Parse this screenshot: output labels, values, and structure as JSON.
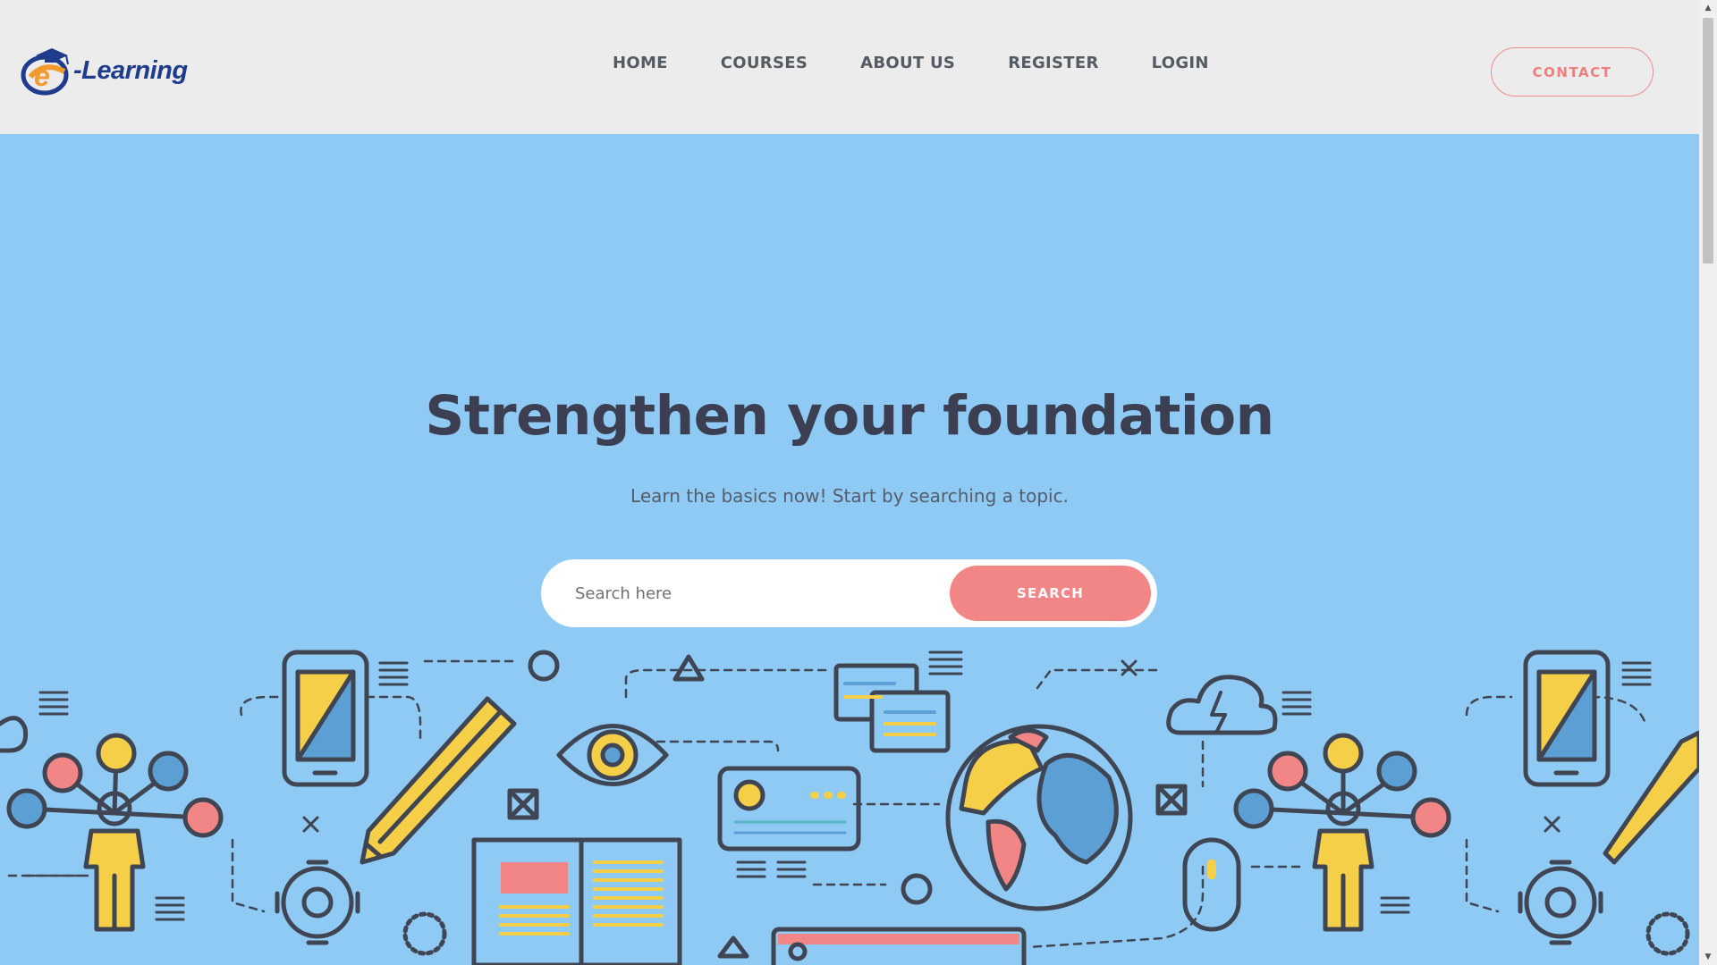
{
  "brand": {
    "logo_text": "-Learning"
  },
  "nav": {
    "items": [
      {
        "label": "HOME"
      },
      {
        "label": "COURSES"
      },
      {
        "label": "ABOUT US"
      },
      {
        "label": "REGISTER"
      },
      {
        "label": "LOGIN"
      }
    ],
    "contact_label": "CONTACT"
  },
  "hero": {
    "title": "Strengthen your foundation",
    "subtitle": "Learn the basics now! Start by searching a topic.",
    "search": {
      "placeholder": "Search here",
      "value": "",
      "button_label": "SEARCH"
    }
  },
  "colors": {
    "hero_bg": "#8ecaf4",
    "header_bg": "#ececec",
    "accent": "#f28585",
    "illustration_yellow": "#f5cf47",
    "illustration_blue": "#5b9fd4",
    "illustration_stroke": "#3f4552"
  },
  "illustration": {
    "icons": [
      "person-network-icon",
      "phone-icon",
      "pencil-icon",
      "gear-icon",
      "eye-icon",
      "open-book-icon",
      "chat-icon",
      "card-icon",
      "globe-icon",
      "cloud-icon",
      "mouse-icon",
      "calendar-icon"
    ]
  }
}
